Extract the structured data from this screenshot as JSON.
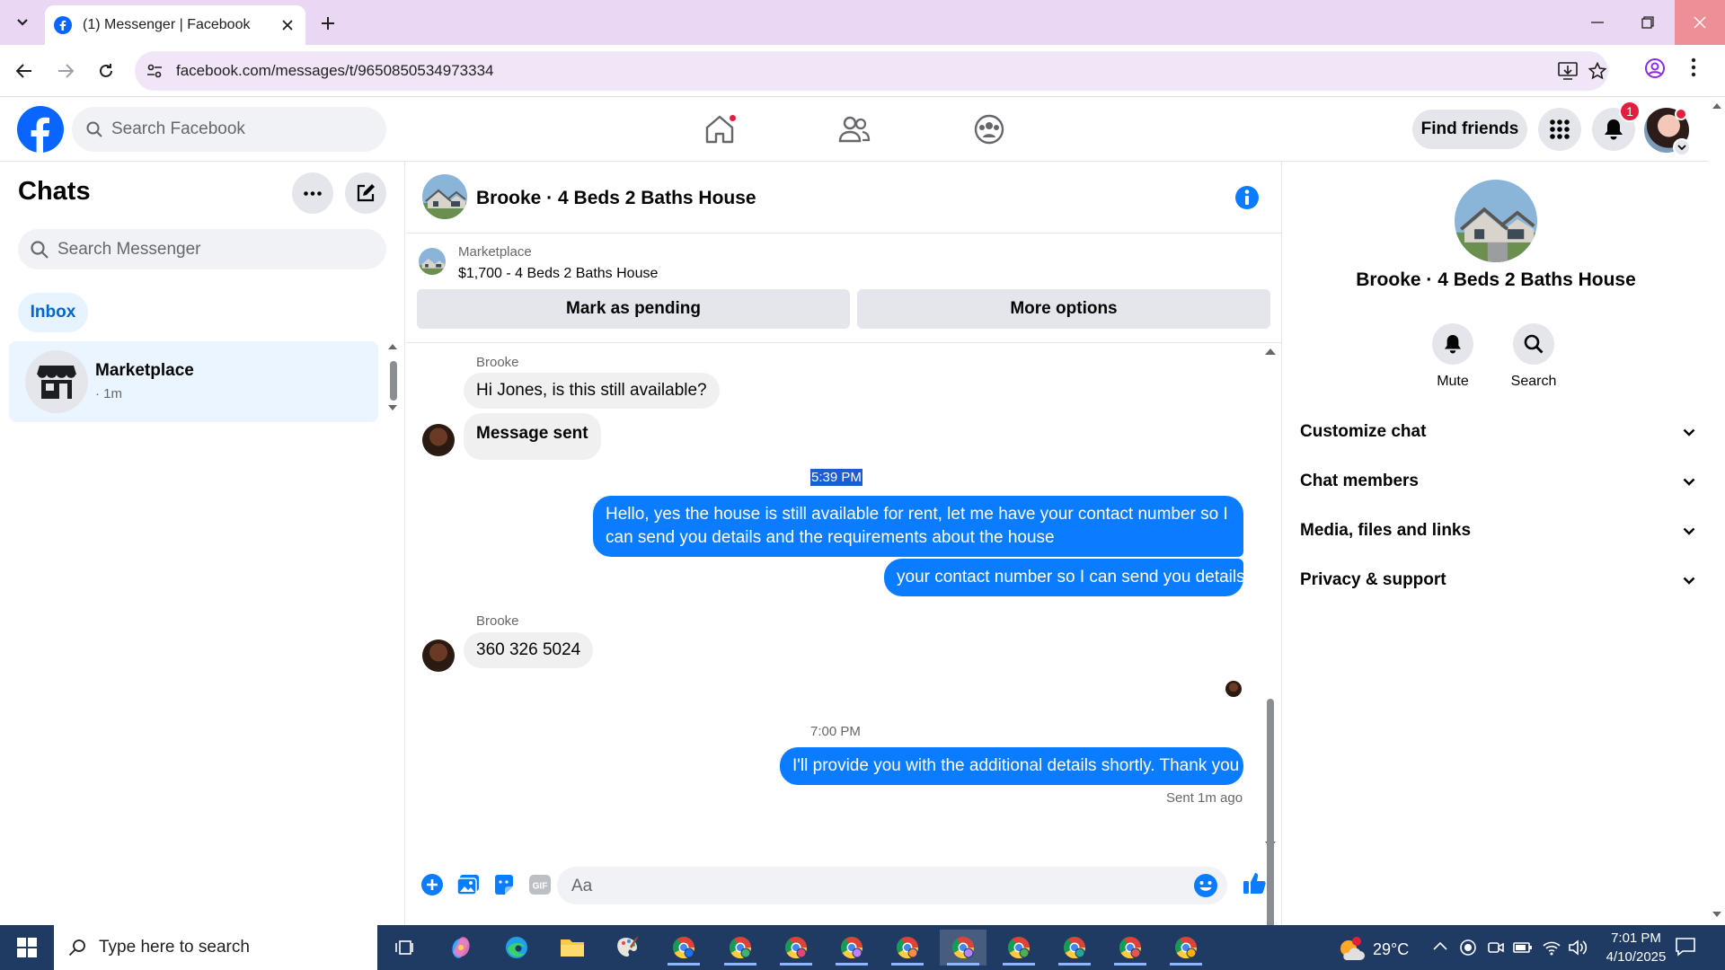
{
  "browser": {
    "tab_title": "(1) Messenger | Facebook",
    "url": "facebook.com/messages/t/9650850534973334"
  },
  "fb_header": {
    "search_placeholder": "Search Facebook",
    "find_friends": "Find friends",
    "notification_count": "1"
  },
  "left": {
    "title": "Chats",
    "search_placeholder": "Search Messenger",
    "filter": "Inbox",
    "chats": [
      {
        "name": "Marketplace",
        "time": "· 1m"
      }
    ]
  },
  "conversation": {
    "title": "Brooke · 4 Beds 2 Baths House",
    "marketplace_label": "Marketplace",
    "listing": "$1,700 - 4 Beds 2 Baths House",
    "mark_pending": "Mark as pending",
    "more_options": "More options",
    "messages": {
      "sender1": "Brooke",
      "m1": "Hi Jones, is this still available?",
      "m2": "Message sent",
      "time1": "5:39 PM",
      "m3": "Hello, yes the house is still available for rent, let me have your contact number so I can send you details and the requirements about the house",
      "m4": "your contact number so I can send you details",
      "sender2": "Brooke",
      "m5": "360 326 5024",
      "time2": "7:00 PM",
      "m6": "I'll provide you with the additional details shortly. Thank you",
      "status": "Sent 1m ago"
    },
    "composer_placeholder": "Aa"
  },
  "right": {
    "name": "Brooke · 4 Beds 2 Baths House",
    "actions": [
      "Mute",
      "Search"
    ],
    "sections": [
      "Customize chat",
      "Chat members",
      "Media, files and links",
      "Privacy & support"
    ]
  },
  "taskbar": {
    "search_placeholder": "Type here to search",
    "temperature": "29°C",
    "time": "7:01 PM",
    "date": "4/10/2025"
  },
  "colors": {
    "fb_blue": "#0866ff",
    "bubble_out": "#0a7cff",
    "bubble_in": "#f0f0f0",
    "tabbar": "#e9d7f3",
    "taskbar": "#1f3a63"
  }
}
